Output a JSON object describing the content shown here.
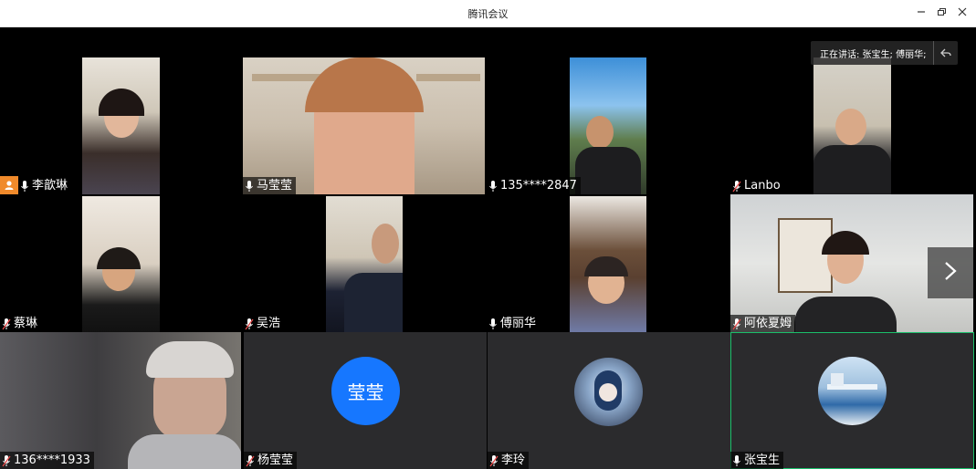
{
  "window": {
    "title": "腾讯会议"
  },
  "speaking": {
    "label": "正在讲话: 张宝生; 傅丽华;"
  },
  "participants": [
    {
      "name": "李歆琳",
      "kind": "video"
    },
    {
      "name": "马莹莹",
      "kind": "video"
    },
    {
      "name": "135****2847",
      "kind": "video"
    },
    {
      "name": "Lanbo",
      "kind": "video"
    },
    {
      "name": "蔡琳",
      "kind": "video"
    },
    {
      "name": "吴浩",
      "kind": "video"
    },
    {
      "name": "傅丽华",
      "kind": "video"
    },
    {
      "name": "阿依夏姆",
      "kind": "video"
    },
    {
      "name": "136****1933",
      "kind": "video"
    },
    {
      "name": "杨莹莹",
      "kind": "avatar",
      "avatar_text": "莹莹",
      "avatar_color": "#1677ff"
    },
    {
      "name": "李玲",
      "kind": "avatar"
    },
    {
      "name": "张宝生",
      "kind": "avatar",
      "active": true
    }
  ],
  "colors": {
    "background": "#000000",
    "tile_gray": "#2b2b2d",
    "active_border": "#1bbf6a",
    "host_badge": "#f08a2b"
  },
  "icons": [
    "minimize-icon",
    "restore-icon",
    "close-icon",
    "microphone-icon",
    "host-icon",
    "reply-icon",
    "chevron-right-icon"
  ]
}
